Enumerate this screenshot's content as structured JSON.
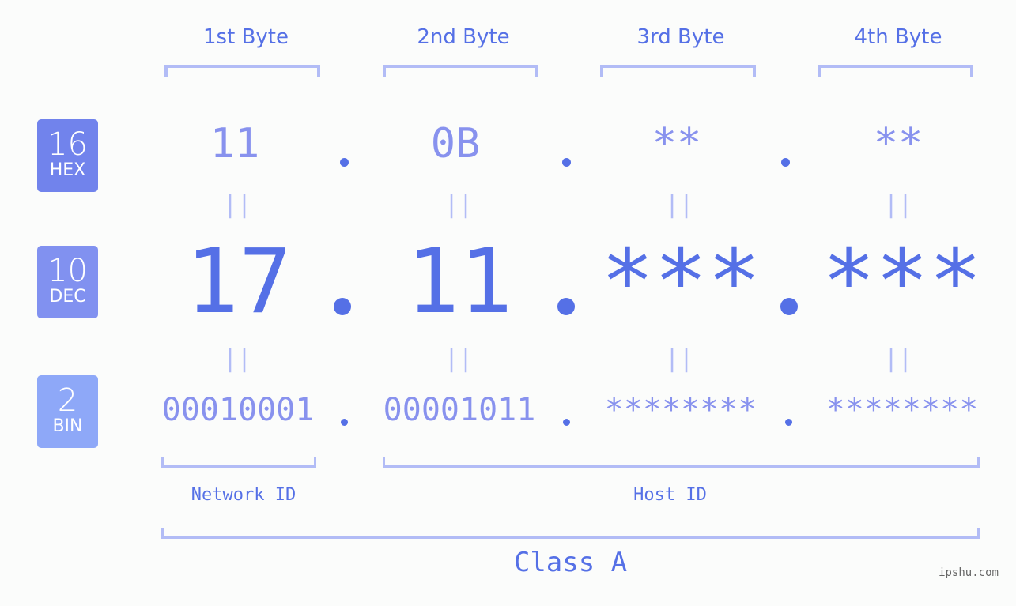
{
  "badges": [
    {
      "base": "16",
      "label": "HEX",
      "color": "#7183ec"
    },
    {
      "base": "10",
      "label": "DEC",
      "color": "#8191f0"
    },
    {
      "base": "2",
      "label": "BIN",
      "color": "#8ea8f8"
    }
  ],
  "headers": [
    "1st Byte",
    "2nd Byte",
    "3rd Byte",
    "4th Byte"
  ],
  "hex": [
    "11",
    "0B",
    "**",
    "**"
  ],
  "dec": [
    "17",
    "11",
    "***",
    "***"
  ],
  "bin": [
    "00010001",
    "00001011",
    "********",
    "********"
  ],
  "equals_glyph": "||",
  "labels": {
    "network": "Network ID",
    "host": "Host ID",
    "class": "Class A"
  },
  "watermark": "ipshu.com",
  "colors": {
    "accent": "#5570e6",
    "light": "#8892ee",
    "bracket": "#b2bcf6"
  }
}
